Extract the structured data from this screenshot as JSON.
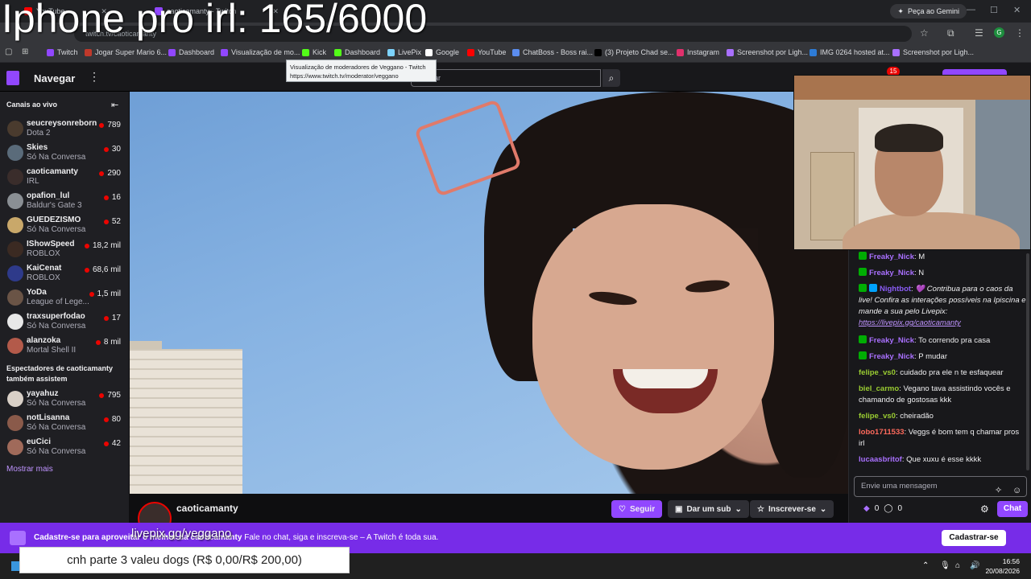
{
  "browser": {
    "tabs": [
      {
        "title": "YouTube",
        "color": "#ff0000"
      },
      {
        "title": "caoticamanty - Twitch",
        "color": "#9147ff"
      }
    ],
    "gemini_label": "Peça ao Gemini",
    "url_text": "twitch.tv/caoticamanty",
    "bookmarks": [
      {
        "label": "Twitch",
        "color": "#9147ff"
      },
      {
        "label": "Jogar Super Mario 6...",
        "color": "#c0392b"
      },
      {
        "label": "Dashboard",
        "color": "#9147ff"
      },
      {
        "label": "Visualização de mo...",
        "color": "#9147ff"
      },
      {
        "label": "Kick",
        "color": "#53fc18"
      },
      {
        "label": "Dashboard",
        "color": "#53fc18"
      },
      {
        "label": "LivePix",
        "color": "#7dd3fc"
      },
      {
        "label": "Google",
        "color": "#ffffff"
      },
      {
        "label": "YouTube",
        "color": "#ff0000"
      },
      {
        "label": "ChatBoss - Boss rai...",
        "color": "#5b8def"
      },
      {
        "label": "(3) Projeto Chad se...",
        "color": "#000000"
      },
      {
        "label": "Instagram",
        "color": "#e1306c"
      },
      {
        "label": "Screenshot por Ligh...",
        "color": "#a970ff"
      },
      {
        "label": "IMG 0264 hosted at...",
        "color": "#2d7bd6"
      },
      {
        "label": "Screenshot por Ligh...",
        "color": "#a970ff"
      }
    ],
    "tooltip": {
      "title": "Visualização de moderadores de Veggano - Twitch",
      "url": "https://www.twitch.tv/moderator/veggano"
    }
  },
  "twitch": {
    "nav_title": "Navegar",
    "search_placeholder": "Buscar",
    "notifications": "15"
  },
  "sidebar": {
    "live_header": "Canais ao vivo",
    "channels": [
      {
        "name": "seucreysonreborn",
        "game": "Dota 2",
        "viewers": "789",
        "avatar": "#4a3b2e"
      },
      {
        "name": "Skies",
        "game": "Só Na Conversa",
        "viewers": "30",
        "avatar": "#5a6b7a"
      },
      {
        "name": "caoticamanty",
        "game": "IRL",
        "viewers": "290",
        "avatar": "#3a2d2b"
      },
      {
        "name": "opafion_lul",
        "game": "Baldur's Gate 3",
        "viewers": "16",
        "avatar": "#8a8f94"
      },
      {
        "name": "GUEDEZISMO",
        "game": "Só Na Conversa",
        "viewers": "52",
        "avatar": "#c9a86a"
      },
      {
        "name": "IShowSpeed",
        "game": "ROBLOX",
        "viewers": "18,2 mil",
        "avatar": "#3b2a22"
      },
      {
        "name": "KaiCenat",
        "game": "ROBLOX",
        "viewers": "68,6 mil",
        "avatar": "#2e3a8a"
      },
      {
        "name": "YoDa",
        "game": "League of Lege...",
        "viewers": "1,5 mil",
        "avatar": "#6a5446"
      },
      {
        "name": "traxsuperfodao",
        "game": "Só Na Conversa",
        "viewers": "17",
        "avatar": "#e8e8e8"
      },
      {
        "name": "alanzoka",
        "game": "Mortal Shell II",
        "viewers": "8 mil",
        "avatar": "#b35a4a"
      }
    ],
    "also_header": "Espectadores de caoticamanty também assistem",
    "also_channels": [
      {
        "name": "yayahuz",
        "game": "Só Na Conversa",
        "viewers": "795",
        "avatar": "#d9d0c7"
      },
      {
        "name": "notLisanna",
        "game": "Só Na Conversa",
        "viewers": "80",
        "avatar": "#8a5a4a"
      },
      {
        "name": "euCici",
        "game": "Só Na Conversa",
        "viewers": "42",
        "avatar": "#a06a5a"
      }
    ],
    "show_more": "Mostrar mais"
  },
  "stream": {
    "streamer": "caoticamanty",
    "follow_label": "Seguir",
    "sub_label": "Dar um sub",
    "subscribe_label": "Inscrever-se"
  },
  "chat": {
    "messages": [
      {
        "user": "Freaky_Nick",
        "color": "#a970ff",
        "badge": "vip",
        "text": "M"
      },
      {
        "user": "Freaky_Nick",
        "color": "#a970ff",
        "badge": "vip",
        "text": "N"
      },
      {
        "user": "Nightbot",
        "color": "#8a5cf6",
        "badge": "bot",
        "text": "💜 Contribua para o caos da live! Confira as interações possíveis na Ipiscina e mande a sua pelo Livepix:",
        "link": "https://livepix.gg/caoticamanty"
      },
      {
        "user": "Freaky_Nick",
        "color": "#a970ff",
        "badge": "vip",
        "text": "To correndo pra casa"
      },
      {
        "user": "Freaky_Nick",
        "color": "#a970ff",
        "badge": "vip",
        "text": "P mudar"
      },
      {
        "user": "felipe_vs0",
        "color": "#9acd32",
        "badge": "",
        "text": "cuidado pra ele n te esfaquear"
      },
      {
        "user": "biel_carmo",
        "color": "#9acd32",
        "badge": "",
        "text": "Vegano tava assistindo vocês e chamando de gostosas kkk"
      },
      {
        "user": "felipe_vs0",
        "color": "#9acd32",
        "badge": "",
        "text": "cheiradão"
      },
      {
        "user": "lobo1711533",
        "color": "#ff6a5c",
        "badge": "",
        "text": "Veggs é bom tem q chamar pros irl"
      },
      {
        "user": "lucaasbritof",
        "color": "#a970ff",
        "badge": "",
        "text": "Que xuxu é esse kkkk"
      }
    ],
    "input_placeholder": "Envie uma mensagem",
    "bits": "0",
    "points": "0",
    "chat_button": "Chat"
  },
  "banner": {
    "bold": "Cadastre-se para aproveitar o melhor da caoticamanty",
    "text": "Fale no chat, siga e inscreva-se – A Twitch é toda sua.",
    "button": "Cadastrar-se"
  },
  "taskbar": {
    "time": "16:56",
    "date": "20/08/2026"
  },
  "overlay": {
    "title": "Iphone pro irl: 165/6000",
    "livepix": "livepix.gg/veggano",
    "goal": "cnh parte 3 valeu dogs (R$ 0,00/R$ 200,00)"
  }
}
